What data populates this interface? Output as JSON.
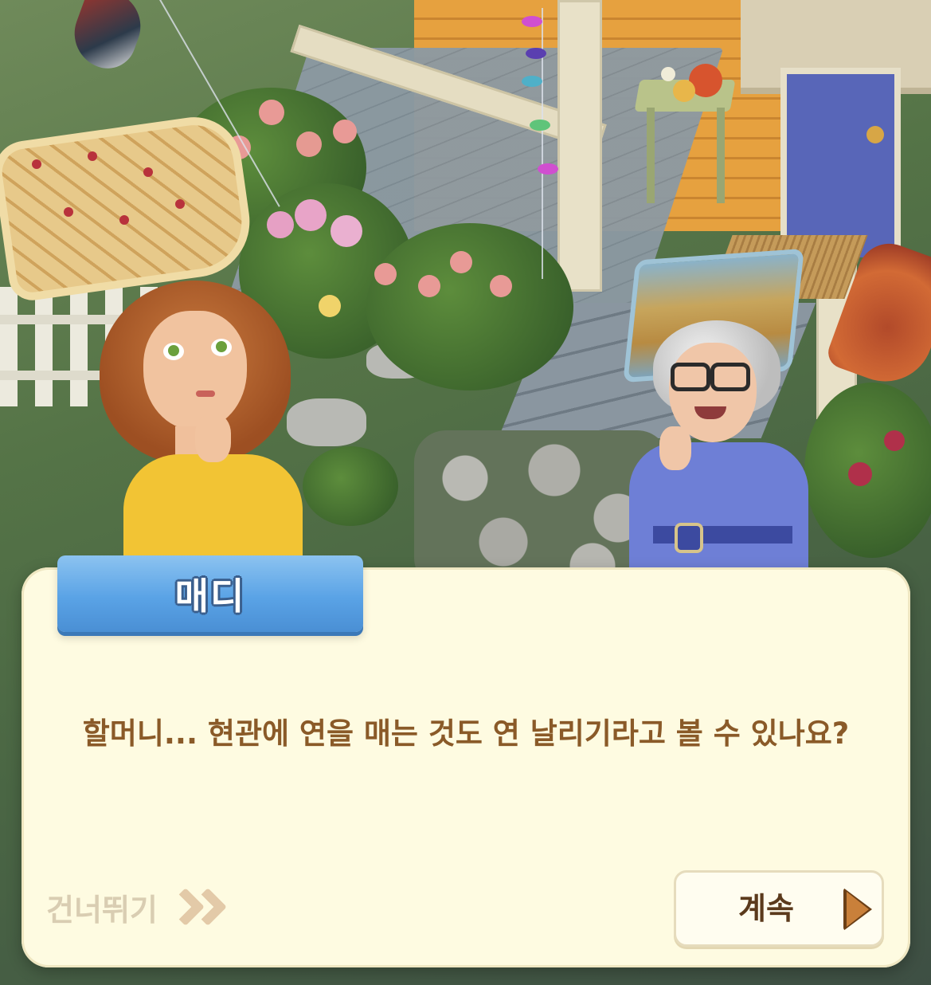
{
  "dialog": {
    "speaker": "매디",
    "text": "할머니... 현관에 연을 매는 것도 연 날리기라고 볼 수 있나요?",
    "skip_label": "건너뛰기",
    "continue_label": "계속"
  },
  "icons": {
    "skip": "double-chevron-right-icon",
    "continue": "play-triangle-icon"
  },
  "colors": {
    "dialog_bg": "#fefbe1",
    "name_tag": "#5aa3e6",
    "dialog_text": "#8a5a28",
    "skip_text": "#d9cdb2",
    "continue_text": "#5b3a1c"
  }
}
